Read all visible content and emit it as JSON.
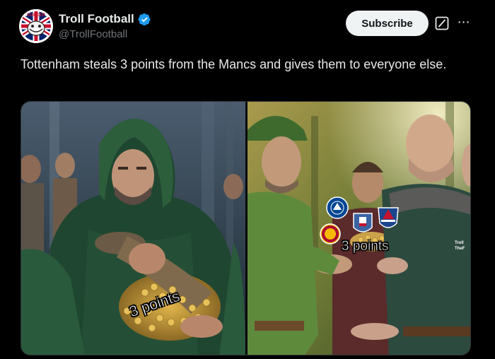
{
  "author": {
    "display_name": "Troll Football",
    "handle": "@TrollFootball",
    "verified": true,
    "avatar_icon": "troll-face-union-jack-avatar"
  },
  "actions": {
    "subscribe_label": "Subscribe",
    "grok_icon": "grok-icon",
    "more_icon": "more-options-icon"
  },
  "tweet": {
    "text": "Tottenham steals 3 points from the Mancs and gives them to everyone else."
  },
  "media": {
    "left_caption": "3 points",
    "right_caption": "3 points",
    "watermark_lines": [
      "Troll",
      "TheF"
    ],
    "club_badges": [
      "chelsea-badge-icon",
      "ipswich-badge-icon",
      "crystal-palace-badge-icon",
      "galatasaray-badge-icon"
    ]
  },
  "colors": {
    "background": "#000000",
    "text_primary": "#e7e9ea",
    "text_secondary": "#71767b",
    "verified_blue": "#1d9bf0",
    "subscribe_bg": "#eff3f4"
  }
}
